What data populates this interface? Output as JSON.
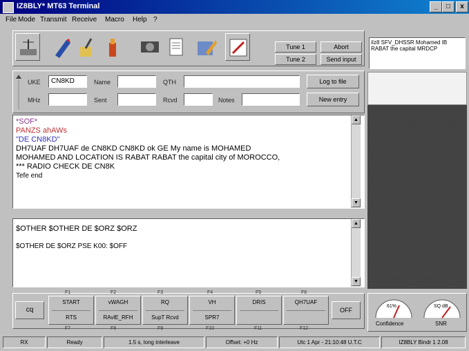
{
  "window": {
    "title": "IZ8BLY* MT63 Terminal",
    "min": "_",
    "max": "□",
    "close": "x"
  },
  "menu": [
    "File",
    "Mode",
    "Transmit",
    "Receive",
    "Macro",
    "Help",
    "?"
  ],
  "toolbar": {
    "mini_buttons": [
      "Tune 1",
      "Abort",
      "Tune 2",
      "Send input"
    ]
  },
  "top_right_text": "iIz8 SFV_DHSSR Mohamed IB RABAT the capital MRDCP",
  "qso": {
    "fields": {
      "uke_label": "UKE",
      "uke_value": "CN8KD",
      "name_label": "Name",
      "name_value": "",
      "qth_label": "QTH",
      "qth_value": "",
      "mhz_label": "MHz",
      "mhz_value": "",
      "sent_label": "Sent",
      "sent_value": "",
      "rcvd_label": "Rcvd",
      "rcvd_value": "",
      "notes_label": "Notes",
      "notes_value": ""
    },
    "log_button": "Log to file",
    "new_button": "New entry"
  },
  "rx_text": {
    "line1": "*SOF*",
    "line2": "PANZS ahAWs",
    "line3": "\"DE CN8KD\"",
    "line4": "DH7UAF DH7UAF de CN8KD CN8KD ok GE My name is MOHAMED",
    "line5": "MOHAMED AND LOCATION IS RABAT RABAT the capital city of MOROCCO,",
    "line6": "*** RADIO CHECK DE CN8K",
    "line7": "Tefe end"
  },
  "tx_text": {
    "line1": "$OTHER $OTHER DE $ORZ $ORZ",
    "line2": "$OTHER DE $ORZ PSE K00: $OFF"
  },
  "fkeys": [
    {
      "num": "F1",
      "top": "",
      "bot": ""
    },
    {
      "num": "F2",
      "top": "START",
      "bot": "RTS"
    },
    {
      "num": "F3",
      "top": "vWAGH",
      "bot": "RAvlE_RFH"
    },
    {
      "num": "F4",
      "top": "RQ",
      "bot": "SupT Rcvd"
    },
    {
      "num": "F5",
      "top": "VH",
      "bot": "SPR7"
    },
    {
      "num": "F6",
      "top": "DRIS",
      "bot": ""
    },
    {
      "num": "F7",
      "top": "QH7UAF",
      "bot": ""
    }
  ],
  "fnums_bottom": [
    "F7",
    "F8",
    "F9",
    "F10",
    "F11",
    "F12"
  ],
  "cq_label": "cq",
  "off_label": "OFF",
  "meters": [
    {
      "label": "Confidence",
      "value": "61%"
    },
    {
      "label": "SNR",
      "value": "SQ dB"
    }
  ],
  "status": [
    "RX",
    "Ready",
    "1.5 s, long interleave",
    "Offset: +0 Hz",
    "Utc 1 Apr - 21:10:48 U.T.C",
    "IZ8BLY Bindr 1 2.08"
  ]
}
